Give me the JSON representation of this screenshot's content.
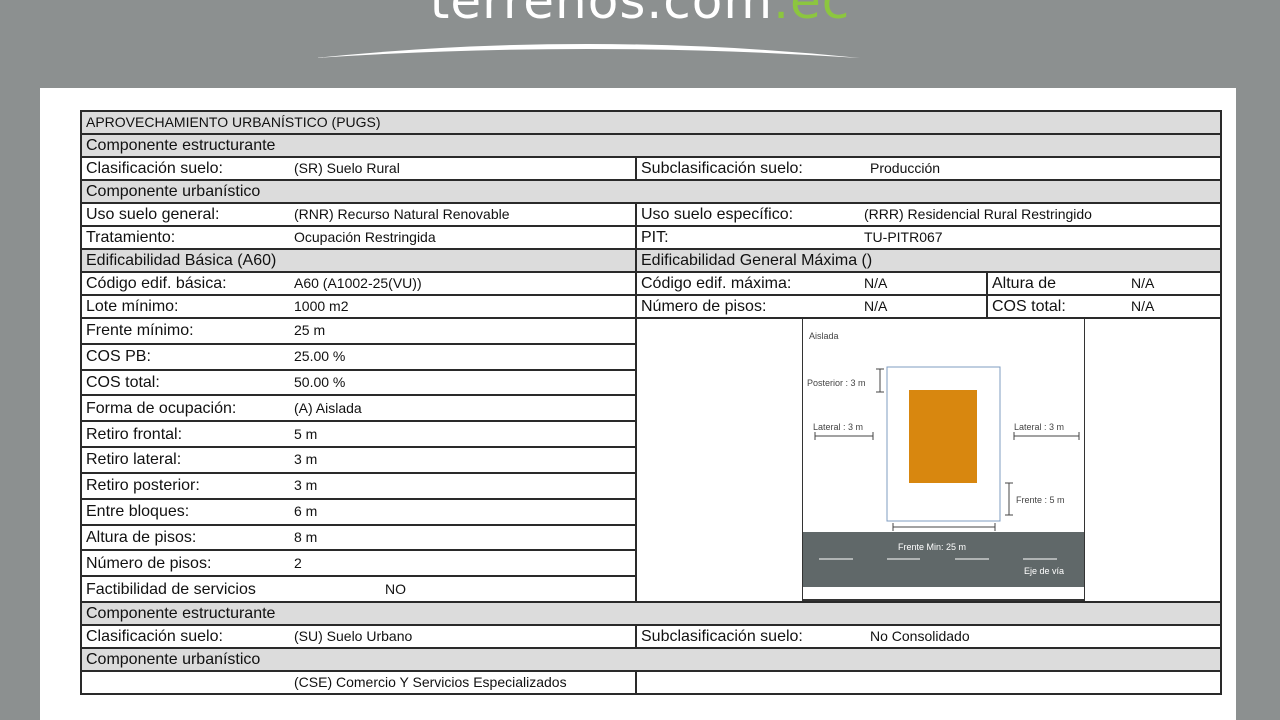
{
  "logo": {
    "main": "terrenos.com",
    "accent": ".ec"
  },
  "colors": {
    "background": "#8c9090",
    "header_fill": "#dcdcdc",
    "building": "#d8870f",
    "road": "#606869",
    "logo_accent": "#8cc63f"
  },
  "table": {
    "title": "APROVECHAMIENTO URBANÍSTICO (PUGS)",
    "comp_estructurante": "Componente  estructurante",
    "clasificacion_label": "Clasificación suelo:",
    "clasificacion_value": "(SR) Suelo Rural",
    "subclasificacion_label": "Subclasificación suelo:",
    "subclasificacion_value": "Producción",
    "comp_urbanistico": "Componente  urbanístico",
    "uso_general_label": "Uso suelo general:",
    "uso_general_value": "(RNR) Recurso Natural Renovable",
    "uso_especifico_label": "Uso suelo específico:",
    "uso_especifico_value": "(RRR) Residencial Rural Restringido",
    "tratamiento_label": "Tratamiento:",
    "tratamiento_value": "Ocupación Restringida",
    "pit_label": "PIT:",
    "pit_value": "TU-PITR067",
    "edif_basica": "Edificabilidad Básica (A60)",
    "edif_maxima": "Edificabilidad General Máxima ()",
    "codigo_basica_label": "Código edif. básica:",
    "codigo_basica_value": "A60 (A1002-25(VU))",
    "codigo_maxima_label": "Código edif. máxima:",
    "codigo_maxima_value": "N/A",
    "altura_de_label": "Altura de",
    "altura_de_value": "N/A",
    "lote_label": "Lote mínimo:",
    "lote_value": "1000 m2",
    "num_pisos_max_label": "Número de pisos:",
    "num_pisos_max_value": "N/A",
    "cos_total_max_label": "COS total:",
    "cos_total_max_value": "N/A",
    "rows": [
      {
        "label": "Frente mínimo:",
        "value": "25 m"
      },
      {
        "label": "COS PB:",
        "value": "25.00 %"
      },
      {
        "label": "COS total:",
        "value": "50.00 %"
      },
      {
        "label": "Forma de ocupación:",
        "value": "(A) Aislada"
      },
      {
        "label": "Retiro frontal:",
        "value": "5 m"
      },
      {
        "label": "Retiro lateral:",
        "value": "3 m"
      },
      {
        "label": "Retiro posterior:",
        "value": "3 m"
      },
      {
        "label": "Entre bloques:",
        "value": "6 m"
      },
      {
        "label": "Altura de pisos:",
        "value": "8 m"
      },
      {
        "label": "Número de pisos:",
        "value": "2"
      },
      {
        "label": "Factibilidad de servicios",
        "value": "NO"
      }
    ],
    "comp_estructurante_2": "Componente  estructurante",
    "clasificacion2_label": "Clasificación suelo:",
    "clasificacion2_value": "(SU) Suelo Urbano",
    "subclasificacion2_label": "Subclasificación suelo:",
    "subclasificacion2_value": "No Consolidado",
    "comp_urbanistico_2": "Componente  urbanístico",
    "cut_row_value": "(CSE) Comercio Y Servicios Especializados"
  },
  "diagram": {
    "title": "Aislada",
    "posterior": "Posterior : 3 m",
    "lateral_left": "Lateral : 3 m",
    "lateral_right": "Lateral : 3 m",
    "frente": "Frente : 5 m",
    "frente_min": "Frente Min: 25 m",
    "eje": "Eje de vía"
  }
}
